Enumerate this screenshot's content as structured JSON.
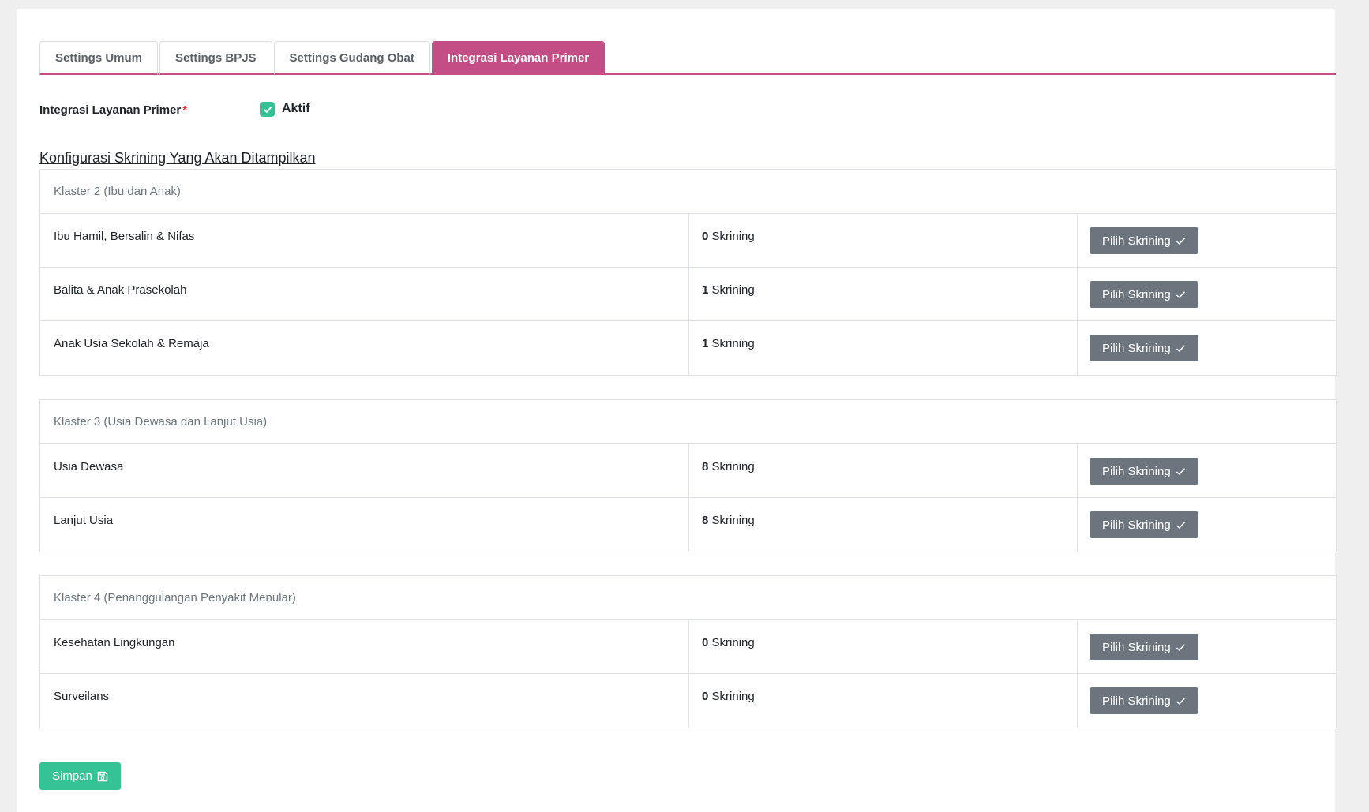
{
  "tabs": [
    {
      "label": "Settings Umum",
      "active": false
    },
    {
      "label": "Settings BPJS",
      "active": false
    },
    {
      "label": "Settings Gudang Obat",
      "active": false
    },
    {
      "label": "Integrasi Layanan Primer",
      "active": true
    }
  ],
  "integration": {
    "label": "Integrasi Layanan Primer",
    "required_mark": "*",
    "checkbox_label": "Aktif",
    "checked": true
  },
  "section_title": "Konfigurasi Skrining Yang Akan Ditampilkan",
  "clusters": [
    {
      "title": "Klaster 2 (Ibu dan Anak)",
      "rows": [
        {
          "name": "Ibu Hamil, Bersalin & Nifas",
          "count": "0",
          "unit": "Skrining",
          "button": "Pilih Skrining"
        },
        {
          "name": "Balita & Anak Prasekolah",
          "count": "1",
          "unit": "Skrining",
          "button": "Pilih Skrining"
        },
        {
          "name": "Anak Usia Sekolah & Remaja",
          "count": "1",
          "unit": "Skrining",
          "button": "Pilih Skrining"
        }
      ]
    },
    {
      "title": "Klaster 3 (Usia Dewasa dan Lanjut Usia)",
      "rows": [
        {
          "name": "Usia Dewasa",
          "count": "8",
          "unit": "Skrining",
          "button": "Pilih Skrining"
        },
        {
          "name": "Lanjut Usia",
          "count": "8",
          "unit": "Skrining",
          "button": "Pilih Skrining"
        }
      ]
    },
    {
      "title": "Klaster 4 (Penanggulangan Penyakit Menular)",
      "rows": [
        {
          "name": "Kesehatan Lingkungan",
          "count": "0",
          "unit": "Skrining",
          "button": "Pilih Skrining"
        },
        {
          "name": "Surveilans",
          "count": "0",
          "unit": "Skrining",
          "button": "Pilih Skrining"
        }
      ]
    }
  ],
  "save_button": "Simpan",
  "icons": {
    "checkbox": "check-icon",
    "pilih": "check-icon",
    "save": "save-icon"
  },
  "colors": {
    "accent": "#c44d85",
    "success": "#35c295",
    "secondary": "#6c757d"
  }
}
